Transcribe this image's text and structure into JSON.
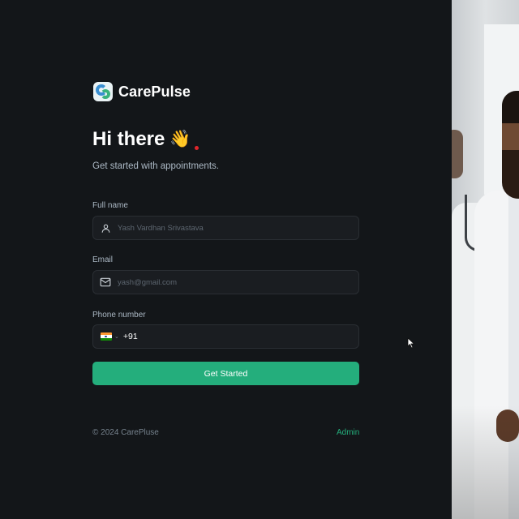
{
  "app": {
    "name": "CarePulse"
  },
  "hero": {
    "greeting": "Hi there",
    "wave": "👋",
    "subtitle": "Get started with appointments."
  },
  "form": {
    "full_name": {
      "label": "Full name",
      "placeholder": "Yash Vardhan Srivastava",
      "icon": "user-icon"
    },
    "email": {
      "label": "Email",
      "placeholder": "yash@gmail.com",
      "icon": "mail-icon"
    },
    "phone": {
      "label": "Phone number",
      "country_flag": "india-flag-icon",
      "value": "+91"
    },
    "submit_label": "Get Started"
  },
  "footer": {
    "copyright": "© 2024 CarePluse",
    "admin_link": "Admin"
  },
  "colors": {
    "background": "#131619",
    "accent": "#24ae7c",
    "input_bg": "#1a1d21",
    "muted_text": "#abb8c4"
  }
}
